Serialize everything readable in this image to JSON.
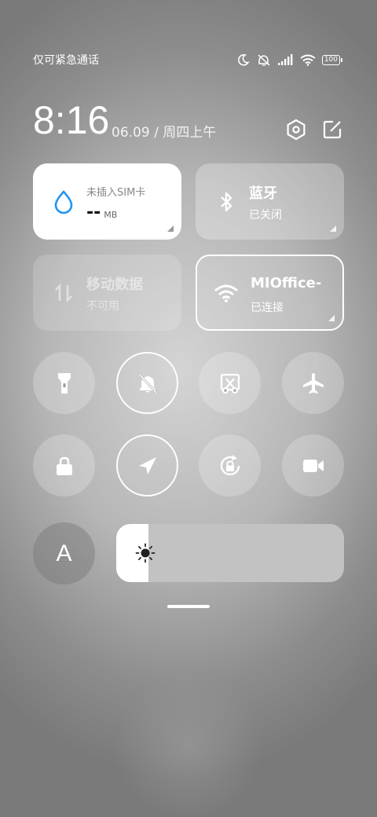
{
  "status": {
    "carrier": "仅可紧急通话",
    "battery": "100",
    "icons": [
      "moon-icon",
      "mute-icon",
      "signal-icon",
      "wifi-icon",
      "battery-icon"
    ]
  },
  "header": {
    "time": "8:16",
    "date": "06.09 / 周四上午",
    "icons": [
      "settings-icon",
      "edit-icon"
    ]
  },
  "tiles": {
    "data": {
      "label": "未插入SIM卡",
      "value": "--",
      "unit": "MB",
      "icon": "water-drop-icon",
      "accent": "#2196f3"
    },
    "bluetooth": {
      "title": "蓝牙",
      "status": "已关闭",
      "icon": "bluetooth-icon"
    },
    "mobile": {
      "title": "移动数据",
      "status": "不可用",
      "icon": "mobile-data-icon"
    },
    "wifi": {
      "title": "MIOffice-",
      "status": "已连接",
      "icon": "wifi-icon"
    }
  },
  "toggles": [
    {
      "name": "flashlight",
      "icon": "flashlight-icon",
      "on": false
    },
    {
      "name": "mute",
      "icon": "mute-bell-icon",
      "on": true
    },
    {
      "name": "screenshot",
      "icon": "screenshot-icon",
      "on": false
    },
    {
      "name": "airplane",
      "icon": "airplane-icon",
      "on": false
    },
    {
      "name": "lock",
      "icon": "lock-icon",
      "on": false
    },
    {
      "name": "location",
      "icon": "location-icon",
      "on": true
    },
    {
      "name": "rotation-lock",
      "icon": "rotation-lock-icon",
      "on": false
    },
    {
      "name": "screen-record",
      "icon": "video-camera-icon",
      "on": false
    }
  ],
  "auto_brightness": {
    "label": "A"
  },
  "brightness": {
    "level": 0.14,
    "icon": "sun-icon"
  }
}
